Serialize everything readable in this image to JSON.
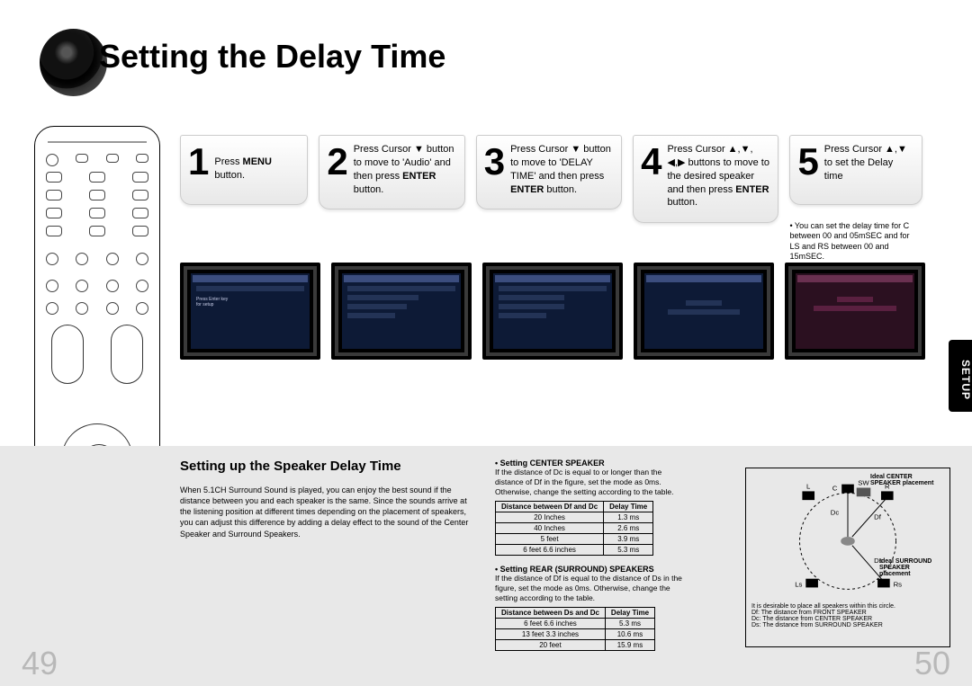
{
  "title": "Setting the Delay Time",
  "section_tab": "SETUP",
  "steps": {
    "s1": {
      "num": "1",
      "text": "Press <b>MENU</b> button."
    },
    "s2": {
      "num": "2",
      "text": "Press Cursor ▼ button to move to 'Audio' and then press <b>ENTER</b> button."
    },
    "s3": {
      "num": "3",
      "text": "Press Cursor ▼ button to move to 'DELAY TIME' and then press <b>ENTER</b> button."
    },
    "s4": {
      "num": "4",
      "text": "Press Cursor ▲,▼, ◀,▶ buttons to move to the desired speaker and then press <b>ENTER</b> button."
    },
    "s5": {
      "num": "5",
      "text": "Press Cursor ▲,▼ to set the Delay time"
    }
  },
  "note": "• You can set the delay time for C between 00 and 05mSEC and for LS and RS between 00 and 15mSEC.",
  "lower": {
    "subtitle": "Setting up the Speaker Delay Time",
    "intro": "When 5.1CH Surround Sound is played, you can enjoy the best sound if the distance between you and each speaker is the same. Since the sounds arrive at the listening position at different times depending on the placement of speakers, you can adjust this difference by adding a delay effect to the sound of the Center Speaker and Surround Speakers.",
    "center_head": "• Setting CENTER SPEAKER",
    "center_body": "If the distance of Dc is equal to or longer than the distance of Df in the figure, set the mode as 0ms. Otherwise, change the setting according to the table.",
    "rear_head": "• Setting REAR (SURROUND) SPEAKERS",
    "rear_body": "If the distance of Df is equal to the distance of Ds in the figure, set the mode as 0ms. Otherwise, change the setting according to the table.",
    "table1": {
      "h1": "Distance between Df and Dc",
      "h2": "Delay Time",
      "rows": [
        [
          "20 Inches",
          "1.3 ms"
        ],
        [
          "40 Inches",
          "2.6 ms"
        ],
        [
          "5 feet",
          "3.9 ms"
        ],
        [
          "6 feet 6.6 inches",
          "5.3 ms"
        ]
      ]
    },
    "table2": {
      "h1": "Distance between Ds and Dc",
      "h2": "Delay Time",
      "rows": [
        [
          "6 feet 6.6 inches",
          "5.3 ms"
        ],
        [
          "13 feet 3.3 inches",
          "10.6 ms"
        ],
        [
          "20 feet",
          "15.9 ms"
        ]
      ]
    },
    "diagram": {
      "ideal_center": "Ideal CENTER SPEAKER placement",
      "ideal_surround": "Ideal SURROUND SPEAKER placement",
      "caption": "It is desirable to place all speakers within this circle.",
      "df": "Df: The distance from FRONT SPEAKER",
      "dc": "Dc: The distance from CENTER SPEAKER",
      "ds": "Ds: The distance from SURROUND SPEAKER",
      "labels": {
        "L": "L",
        "C": "C",
        "SW": "SW",
        "R": "R",
        "Ls": "Ls",
        "Rs": "Rs",
        "Dc": "Dc",
        "Df": "Df",
        "Ds": "Ds"
      }
    }
  },
  "page_left": "49",
  "page_right": "50"
}
